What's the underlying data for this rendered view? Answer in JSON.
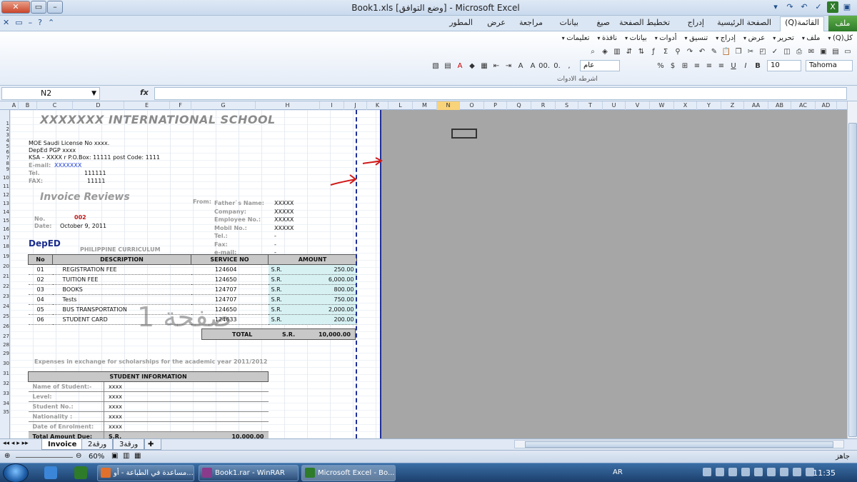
{
  "window": {
    "title": "Microsoft Excel - [وضع التوافق]  Book1.xls"
  },
  "ribbon_tabs": [
    "ملف",
    "(Q)القائمة",
    "الصفحة الرئيسية",
    "إدراج",
    "تخطيط الصفحة",
    "صيغ",
    "بيانات",
    "مراجعة",
    "عرض",
    "المطور"
  ],
  "ribbon_menu": [
    "كل(Q)",
    "ملف",
    "تحرير",
    "عرض",
    "إدراج",
    "تنسيق",
    "أدوات",
    "بيانات",
    "نافذة",
    "تعليمات"
  ],
  "ribbon": {
    "font_name": "Tahoma",
    "font_size": "10",
    "number_format": "عام",
    "group_label": "اشرطه الادوات"
  },
  "formula_bar": {
    "name_box": "N2",
    "fx": "fx",
    "value": ""
  },
  "columns": [
    "A",
    "B",
    "C",
    "D",
    "E",
    "F",
    "G",
    "H",
    "I",
    "J",
    "K",
    "L",
    "M",
    "N",
    "O",
    "P",
    "Q",
    "R",
    "S",
    "T",
    "U",
    "V",
    "W",
    "X",
    "Y",
    "Z",
    "AA",
    "AB",
    "AC",
    "AD"
  ],
  "rows": [
    "1",
    "2",
    "3",
    "4",
    "5",
    "6",
    "7",
    "8",
    "9",
    "10",
    "11",
    "12",
    "13",
    "14",
    "15",
    "16",
    "17",
    "18",
    "19",
    "20",
    "21",
    "22",
    "23",
    "24",
    "25",
    "26",
    "27",
    "28",
    "29",
    "30",
    "31",
    "32",
    "33",
    "34",
    "35"
  ],
  "invoice": {
    "school_name": "XXXXXXX  INTERNATIONAL SCHOOL",
    "license": "MOE Saudi License No xxxx.",
    "deped": "DepEd PGP xxxx",
    "address": "KSA – XXXX r P.O.Box: 11111 post Code: 1111",
    "email_label": "E-mail:",
    "email_value": "XXXXXXX",
    "tel_label": "Tel.",
    "tel_value": "111111",
    "fax_label": "FAX:",
    "fax_value": "11111",
    "title": "Invoice Reviews",
    "from_label": "From:",
    "fields": [
      {
        "label": "Father`s Name:",
        "value": "XXXXX"
      },
      {
        "label": "Company:",
        "value": "XXXXX"
      },
      {
        "label": "Employee No.:",
        "value": "XXXXX"
      },
      {
        "label": "Mobil No.:",
        "value": "XXXXX"
      },
      {
        "label": "Tel.:",
        "value": "-"
      },
      {
        "label": "Fax:",
        "value": "-"
      },
      {
        "label": "e-mail:",
        "value": "-"
      }
    ],
    "no_label": "No.",
    "no_value": "002",
    "date_label": "Date:",
    "date_value": "October 9, 2011",
    "logo_text": "DepED",
    "curriculum": "PHILIPPINE CURRICULUM",
    "headers": [
      "No",
      "DESCRIPTION",
      "SERVICE NO",
      "AMOUNT"
    ],
    "currency": "S.R.",
    "items": [
      {
        "no": "01",
        "desc": "REGISTRATION FEE",
        "service": "124604",
        "amount": "250.00"
      },
      {
        "no": "02",
        "desc": "TUITION FEE",
        "service": "124650",
        "amount": "6,000.00"
      },
      {
        "no": "03",
        "desc": "BOOKS",
        "service": "124707",
        "amount": "800.00"
      },
      {
        "no": "04",
        "desc": "Tests",
        "service": "124707",
        "amount": "750.00"
      },
      {
        "no": "05",
        "desc": "BUS TRANSPORTATION",
        "service": "124650",
        "amount": "2,000.00"
      },
      {
        "no": "06",
        "desc": "STUDENT CARD",
        "service": "124633",
        "amount": "200.00"
      }
    ],
    "total_label": "TOTAL",
    "total_value": "10,000.00",
    "watermark": "صفحة 1",
    "expenses_note": "Expenses in exchange for scholarships for the academic year 2011/2012",
    "student_header": "STUDENT INFORMATION",
    "student_fields": [
      {
        "label": "Name of Student:-",
        "value": "xxxx"
      },
      {
        "label": "Level:",
        "value": "xxxx"
      },
      {
        "label": "Student No.:",
        "value": "xxxx"
      },
      {
        "label": "Nationality :",
        "value": "xxxx"
      },
      {
        "label": "Date of Enrolment:",
        "value": "xxxx"
      }
    ],
    "total_due_label": "Total Amount Due:",
    "total_due_currency": "S.R.",
    "total_due_value": "10,000.00"
  },
  "sheet_tabs": [
    "Invoice",
    "ورقة2",
    "ورقة3"
  ],
  "statusbar": {
    "ready": "جاهز",
    "zoom": "60%"
  },
  "taskbar": {
    "items": [
      "مساعدة في الطباعة - أو...",
      "Book1.rar - WinRAR",
      "Microsoft Excel - Bo..."
    ],
    "lang": "AR",
    "clock": "11:35"
  }
}
